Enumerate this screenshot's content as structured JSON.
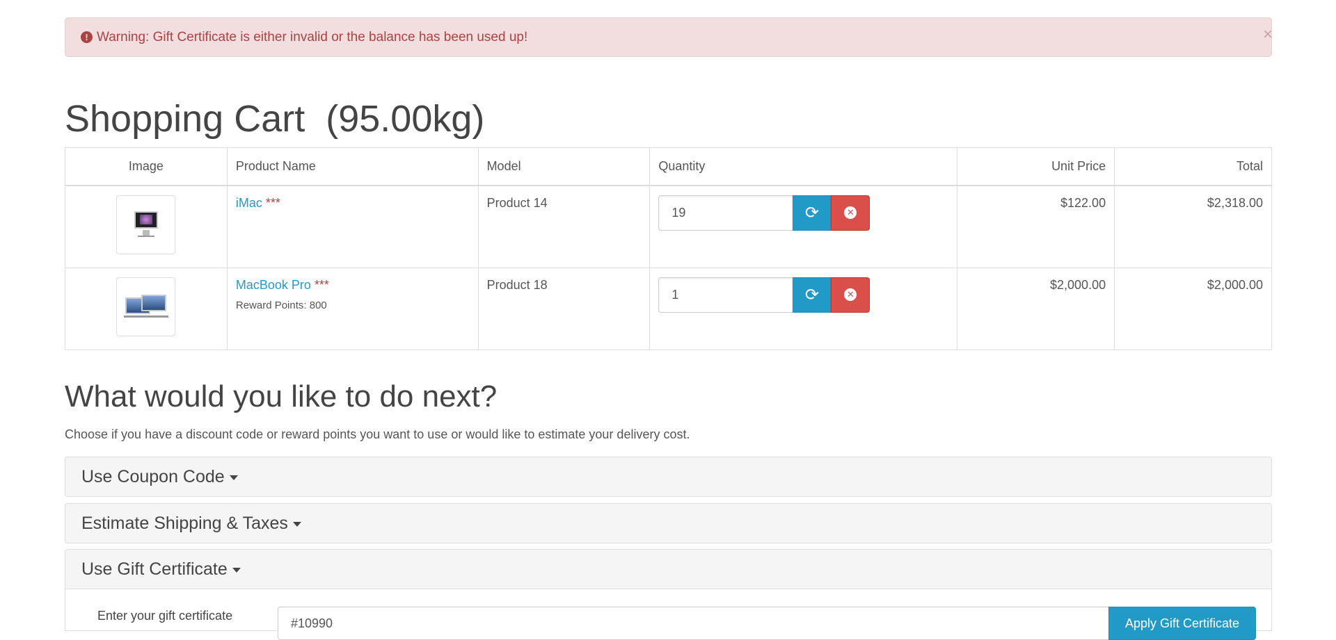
{
  "alert": {
    "text": "Warning: Gift Certificate is either invalid or the balance has been used up!",
    "icon": "exclamation-circle-icon",
    "close": "×"
  },
  "page_title": "Shopping Cart  (95.00kg)",
  "table": {
    "headers": {
      "image": "Image",
      "name": "Product Name",
      "model": "Model",
      "quantity": "Quantity",
      "unit_price": "Unit Price",
      "total": "Total"
    },
    "rows": [
      {
        "name": "iMac",
        "stars": "***",
        "model": "Product 14",
        "quantity": "19",
        "unit_price": "$122.00",
        "total": "$2,318.00"
      },
      {
        "name": "MacBook Pro",
        "stars": "***",
        "reward": "Reward Points: 800",
        "model": "Product 18",
        "quantity": "1",
        "unit_price": "$2,000.00",
        "total": "$2,000.00"
      }
    ]
  },
  "next": {
    "title": "What would you like to do next?",
    "description": "Choose if you have a discount code or reward points you want to use or would like to estimate your delivery cost."
  },
  "panels": {
    "coupon": "Use Coupon Code",
    "shipping": "Estimate Shipping & Taxes",
    "gift": "Use Gift Certificate"
  },
  "gift": {
    "label": "Enter your gift certificate",
    "value": "#10990",
    "button": "Apply Gift Certificate"
  },
  "colors": {
    "link": "#229ac8",
    "danger": "#da4f49",
    "alert_bg": "#f2dede",
    "alert_text": "#a94442"
  }
}
